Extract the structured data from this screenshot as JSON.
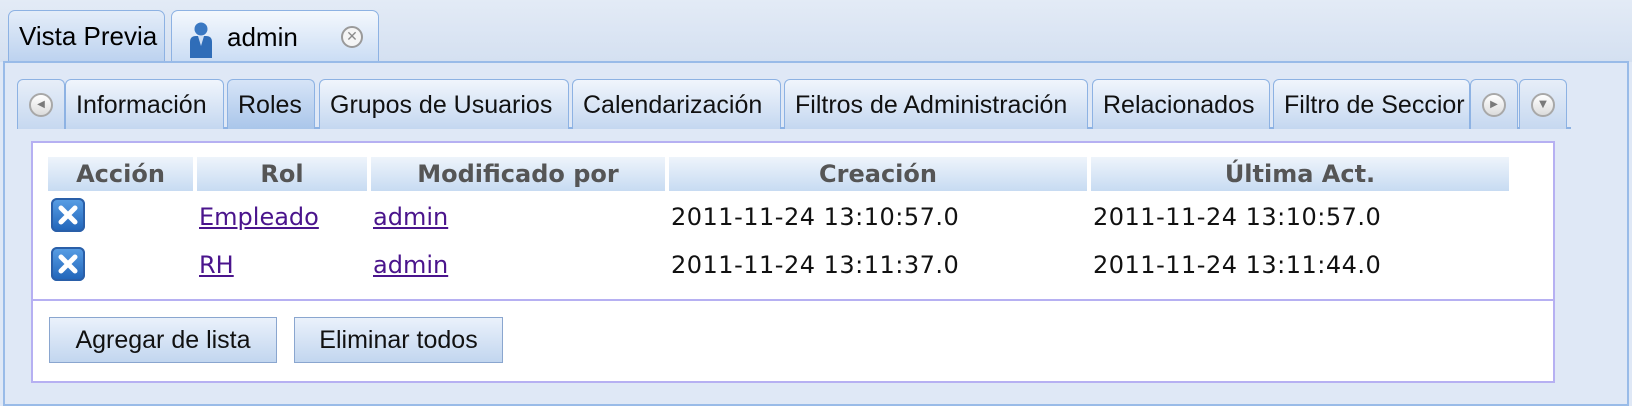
{
  "outer_tabs": {
    "preview_label": "Vista Previa",
    "admin_label": "admin"
  },
  "inner_tabs": [
    {
      "label": "Información"
    },
    {
      "label": "Roles"
    },
    {
      "label": "Grupos de Usuarios"
    },
    {
      "label": "Calendarización"
    },
    {
      "label": "Filtros de Administración"
    },
    {
      "label": "Relacionados"
    },
    {
      "label": "Filtro de Seccior"
    }
  ],
  "table": {
    "headers": [
      "Acción",
      "Rol",
      "Modificado por",
      "Creación",
      "Última Act."
    ],
    "rows": [
      {
        "rol": "Empleado",
        "modificado": "admin",
        "creacion": "2011-11-24 13:10:57.0",
        "ultima": "2011-11-24 13:10:57.0"
      },
      {
        "rol": "RH",
        "modificado": "admin",
        "creacion": "2011-11-24 13:11:37.0",
        "ultima": "2011-11-24 13:11:44.0"
      }
    ]
  },
  "buttons": {
    "add_from_list": "Agregar de lista",
    "delete_all": "Eliminar todos"
  },
  "icons": {
    "user": "user-icon",
    "close": "close-icon",
    "scroll_left": "scroll-left-icon",
    "scroll_right": "scroll-right-icon",
    "tab_menu": "chevron-down-icon",
    "delete": "delete-icon"
  },
  "colors": {
    "accent": "#99bbe8",
    "link": "#4a148c",
    "delete_icon": "#1f63b8"
  }
}
